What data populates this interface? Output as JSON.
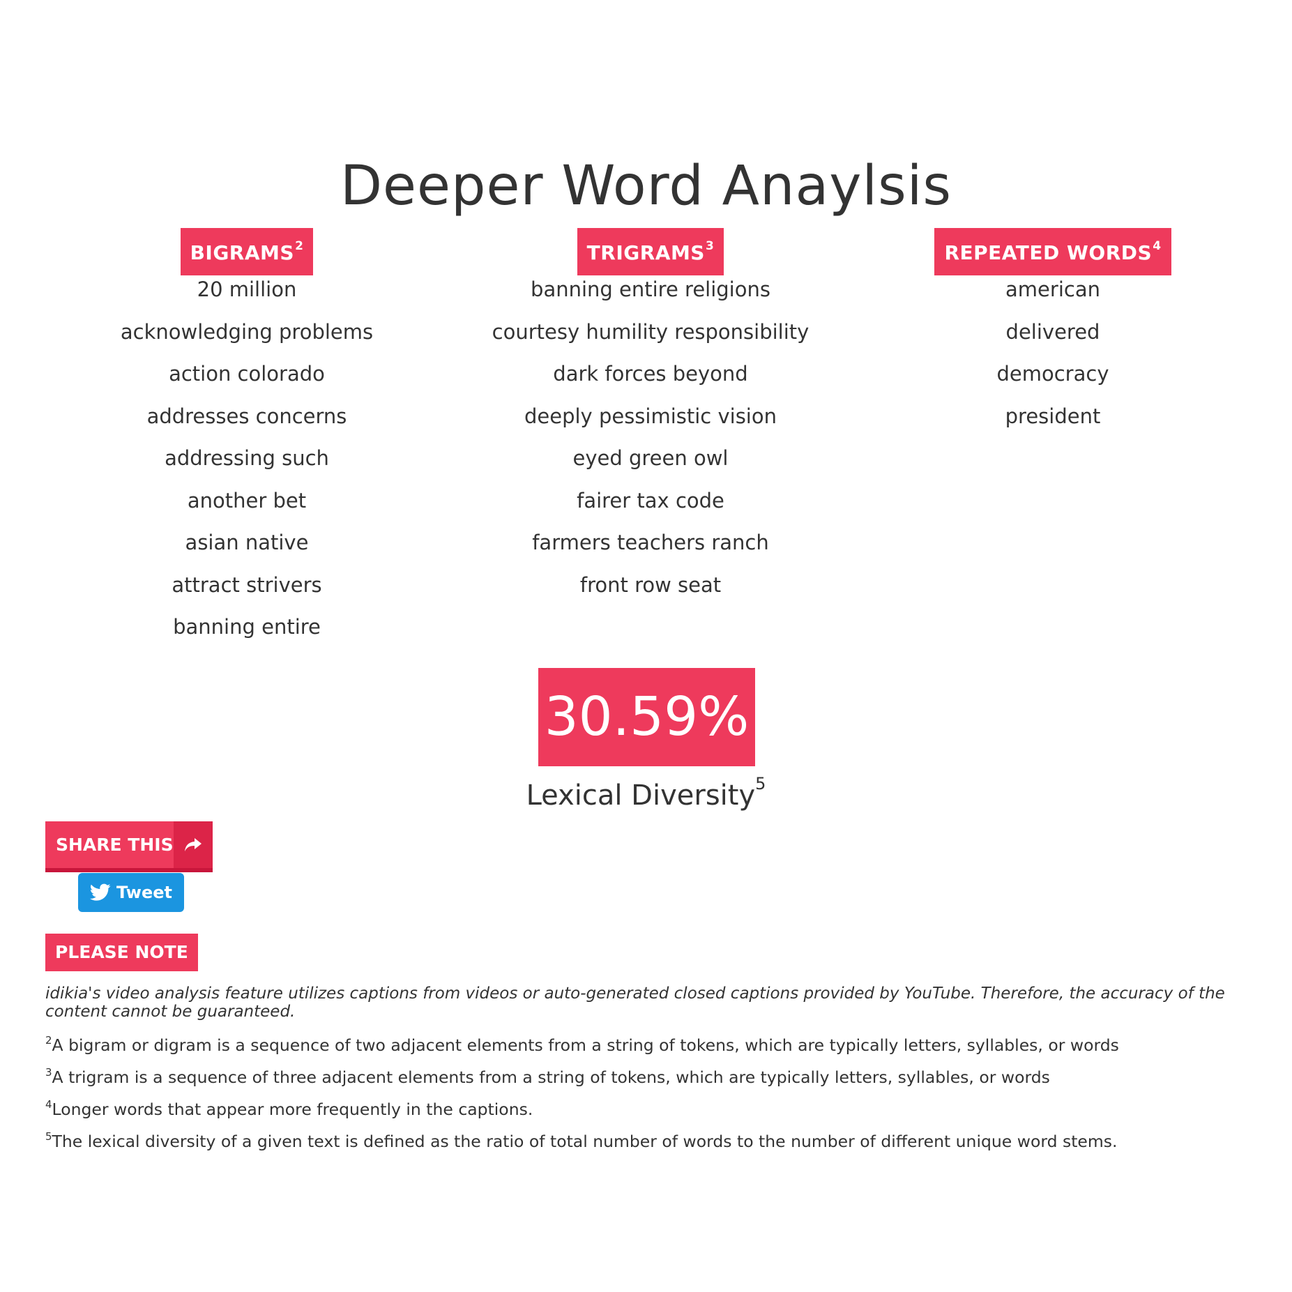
{
  "section": {
    "title": "Deeper Word Anaylsis"
  },
  "bigrams": {
    "label": "BIGRAMS",
    "note_ref": "2",
    "items": [
      "20 million",
      "acknowledging problems",
      "action colorado",
      "addresses concerns",
      "addressing such",
      "another bet",
      "asian native",
      "attract strivers",
      "banning entire"
    ]
  },
  "trigrams": {
    "label": "TRIGRAMS",
    "note_ref": "3",
    "items": [
      "banning entire religions",
      "courtesy humility responsibility",
      "dark forces beyond",
      "deeply pessimistic vision",
      "eyed green owl",
      "fairer tax code",
      "farmers teachers ranch",
      "front row seat"
    ]
  },
  "repeated": {
    "label": "REPEATED WORDS",
    "note_ref": "4",
    "items": [
      "american",
      "delivered",
      "democracy",
      "president"
    ]
  },
  "lexical": {
    "value": "30.59%",
    "label": "Lexical Diversity",
    "note_ref": "5"
  },
  "share": {
    "label": "SHARE THIS",
    "icon": "share-arrow-icon",
    "tweet_label": "Tweet",
    "tweet_icon": "twitter-bird-icon"
  },
  "note": {
    "label": "PLEASE NOTE",
    "disclaimer": "idikia's video analysis feature utilizes captions from videos or auto-generated closed captions provided by YouTube. Therefore, the accuracy of the content cannot be guaranteed."
  },
  "footnotes": [
    {
      "ref": "2",
      "text": "A bigram or digram is a sequence of two adjacent elements from a string of tokens, which are typically letters, syllables, or words"
    },
    {
      "ref": "3",
      "text": "A trigram is a sequence of three adjacent elements from a string of tokens, which are typically letters, syllables, or words"
    },
    {
      "ref": "4",
      "text": "Longer words that appear more frequently in the captions."
    },
    {
      "ref": "5",
      "text": "The lexical diversity of a given text is defined as the ratio of total number of words to the number of different unique word stems."
    }
  ],
  "colors": {
    "accent": "#ee3a5c",
    "accent_dark": "#dc2448",
    "twitter": "#1b95e0",
    "text": "#333333"
  }
}
